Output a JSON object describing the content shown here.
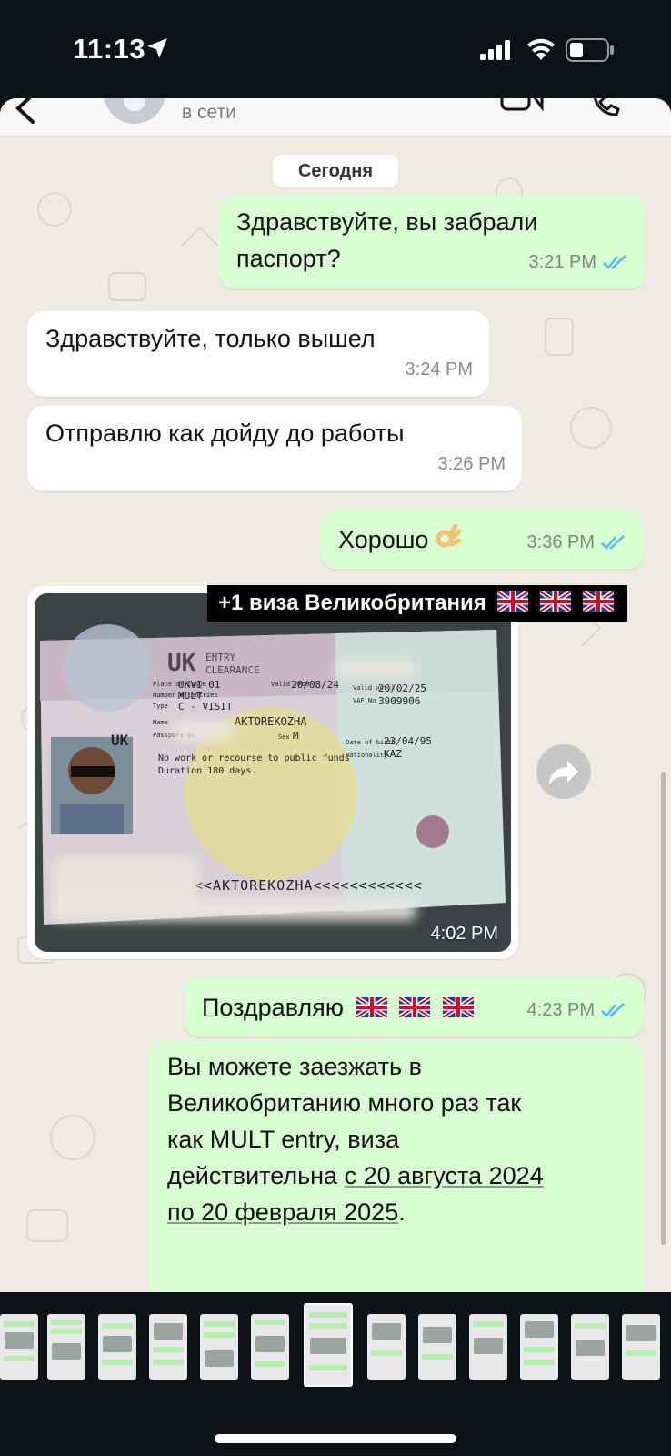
{
  "status_bar": {
    "time": "11:13"
  },
  "header": {
    "contact_status": "в сети"
  },
  "chat": {
    "date_separator": "Сегодня",
    "messages": [
      {
        "direction": "out",
        "text_lines": [
          "Здравствуйте, вы забрали",
          "паспорт?"
        ],
        "time": "3:21 PM",
        "read": true
      },
      {
        "direction": "in",
        "text": "Здравствуйте,  только вышел",
        "time": "3:24 PM"
      },
      {
        "direction": "in",
        "text": "Отправлю как дойду до работы",
        "time": "3:26 PM"
      },
      {
        "direction": "out",
        "text": "Хорошо",
        "emoji": "ok-hand",
        "time": "3:36 PM",
        "read": true
      },
      {
        "direction": "in",
        "type": "photo",
        "time": "4:02 PM"
      },
      {
        "direction": "out",
        "text": "Поздравляю",
        "flags": 3,
        "time": "4:23 PM",
        "read": true
      },
      {
        "direction": "out",
        "text_lines": [
          "Вы можете заезжать в",
          "Великобританию много раз так",
          "как MULT entry, виза",
          "действительна ",
          "с 20 августа 2024",
          "по 20 февраля 2025",
          "."
        ]
      }
    ]
  },
  "overlay_caption": {
    "text": "+1 виза Великобритания",
    "flags": 3
  },
  "visa_photo": {
    "header_uk": "UK",
    "entry": "ENTRY",
    "clearance": "CLEARANCE",
    "place_label": "Place of Issue",
    "place": "UKVI 01",
    "entries_label": "Number of entries",
    "entries": "MULT",
    "type_label": "Type",
    "type": "C - VISIT",
    "valid_from_label": "Valid from",
    "valid_from": "20/08/24",
    "valid_until_label": "Valid until",
    "valid_until": "20/02/25",
    "vaf_label": "VAF No",
    "vaf": "3909906",
    "name_label": "Name",
    "name": "AKTOREKOZHA",
    "passport_label": "Passport No",
    "sex_label": "Sex",
    "sex": "M",
    "dob_label": "Date of birth",
    "dob": "23/04/95",
    "nationality_label": "Nationality",
    "nationality": "KAZ",
    "country_code": "UK",
    "remark1": "No work or recourse to public funds",
    "remark2": "Duration 180 days.",
    "mrz": "<<AKTOREKOZHA<<<<<<<<<<<<"
  },
  "colors": {
    "outgoing": "#d9fdd3",
    "incoming": "#ffffff",
    "wallpaper": "#efeae2",
    "read_ticks": "#53bdeb"
  }
}
